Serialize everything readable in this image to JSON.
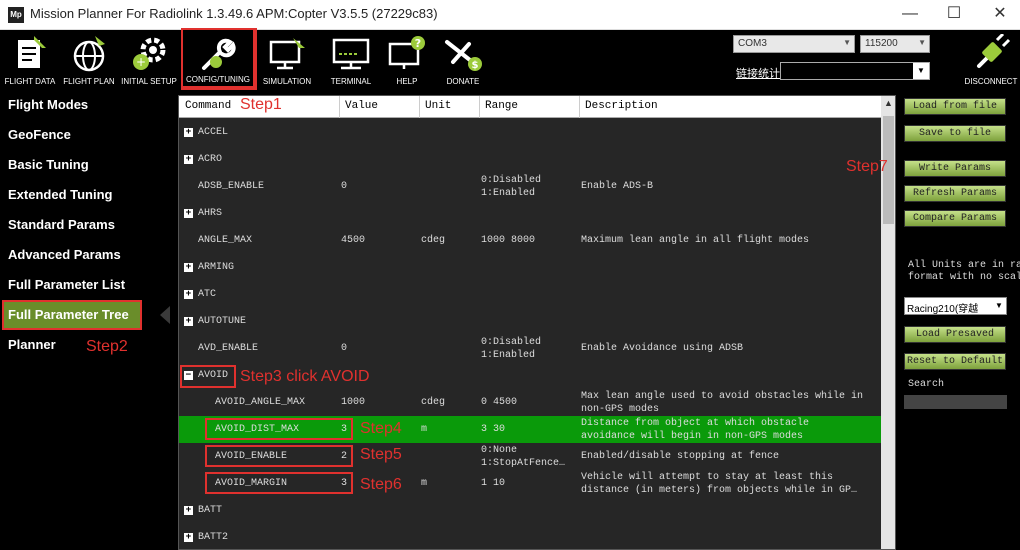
{
  "window": {
    "logo": "Mp",
    "title": "Mission Planner For Radiolink 1.3.49.6 APM:Copter V3.5.5 (27229c83)",
    "minimize": "—",
    "maximize": "☐",
    "close": "✕"
  },
  "toolbar": {
    "buttons": [
      {
        "label": "FLIGHT DATA"
      },
      {
        "label": "FLIGHT PLAN"
      },
      {
        "label": "INITIAL SETUP"
      },
      {
        "label": "CONFIG/TUNING"
      },
      {
        "label": "SIMULATION"
      },
      {
        "label": "TERMINAL"
      },
      {
        "label": "HELP"
      },
      {
        "label": "DONATE"
      }
    ],
    "port": "COM3",
    "baud": "115200",
    "link_stats": "链接统计",
    "disconnect": "DISCONNECT"
  },
  "leftmenu": {
    "items": [
      "Flight Modes",
      "GeoFence",
      "Basic Tuning",
      "Extended Tuning",
      "Standard Params",
      "Advanced Params",
      "Full Parameter List",
      "Full Parameter Tree",
      "Planner"
    ]
  },
  "tree": {
    "headers": {
      "command": "Command",
      "value": "Value",
      "unit": "Unit",
      "range": "Range",
      "description": "Description"
    },
    "rows": [
      {
        "command": "ACCEL",
        "value": "",
        "unit": "",
        "range1": "",
        "range2": "",
        "desc1": "",
        "desc2": ""
      },
      {
        "command": "ACRO",
        "value": "",
        "unit": "",
        "range1": "",
        "range2": "",
        "desc1": "",
        "desc2": ""
      },
      {
        "command": "ADSB_ENABLE",
        "value": "0",
        "unit": "",
        "range1": "0:Disabled",
        "range2": "1:Enabled",
        "desc1": "Enable ADS-B",
        "desc2": ""
      },
      {
        "command": "AHRS",
        "value": "",
        "unit": "",
        "range1": "",
        "range2": "",
        "desc1": "",
        "desc2": ""
      },
      {
        "command": "ANGLE_MAX",
        "value": "4500",
        "unit": "cdeg",
        "range1": "1000 8000",
        "range2": "",
        "desc1": "Maximum lean angle in all flight modes",
        "desc2": ""
      },
      {
        "command": "ARMING",
        "value": "",
        "unit": "",
        "range1": "",
        "range2": "",
        "desc1": "",
        "desc2": ""
      },
      {
        "command": "ATC",
        "value": "",
        "unit": "",
        "range1": "",
        "range2": "",
        "desc1": "",
        "desc2": ""
      },
      {
        "command": "AUTOTUNE",
        "value": "",
        "unit": "",
        "range1": "",
        "range2": "",
        "desc1": "",
        "desc2": ""
      },
      {
        "command": "AVD_ENABLE",
        "value": "0",
        "unit": "",
        "range1": "0:Disabled",
        "range2": "1:Enabled",
        "desc1": "Enable Avoidance using ADSB",
        "desc2": ""
      },
      {
        "command": "AVOID",
        "value": "",
        "unit": "",
        "range1": "",
        "range2": "",
        "desc1": "",
        "desc2": ""
      },
      {
        "command": "AVOID_ANGLE_MAX",
        "value": "1000",
        "unit": "cdeg",
        "range1": "0 4500",
        "range2": "",
        "desc1": "Max lean angle used to avoid obstacles while in",
        "desc2": "non-GPS modes"
      },
      {
        "command": "AVOID_DIST_MAX",
        "value": "3",
        "unit": "m",
        "range1": "3 30",
        "range2": "",
        "desc1": "Distance from object at which obstacle",
        "desc2": "avoidance will begin in non-GPS modes"
      },
      {
        "command": "AVOID_ENABLE",
        "value": "2",
        "unit": "",
        "range1": "0:None",
        "range2": "1:StopAtFence…",
        "desc1": "Enabled/disable stopping at fence",
        "desc2": ""
      },
      {
        "command": "AVOID_MARGIN",
        "value": "3",
        "unit": "m",
        "range1": "1 10",
        "range2": "",
        "desc1": "Vehicle will attempt to stay at least this",
        "desc2": "distance (in meters) from objects while in GP…"
      },
      {
        "command": "BATT",
        "value": "",
        "unit": "",
        "range1": "",
        "range2": "",
        "desc1": "",
        "desc2": ""
      },
      {
        "command": "BATT2",
        "value": "",
        "unit": "",
        "range1": "",
        "range2": "",
        "desc1": "",
        "desc2": ""
      }
    ]
  },
  "steps": {
    "step1": "Step1",
    "step2": "Step2",
    "step3": "Step3 click AVOID",
    "step4": "Step4",
    "step5": "Step5",
    "step6": "Step6",
    "step7": "Step7"
  },
  "rightpanel": {
    "load_from_file": "Load from file",
    "save_to_file": "Save to file",
    "write_params": "Write Params",
    "refresh_params": "Refresh Params",
    "compare_params": "Compare Params",
    "units_note1": "All Units are in ra",
    "units_note2": "format with no scal",
    "preset": "Racing210(穿越",
    "load_presaved": "Load Presaved",
    "reset_default": "Reset to Default",
    "search_label": "Search"
  }
}
